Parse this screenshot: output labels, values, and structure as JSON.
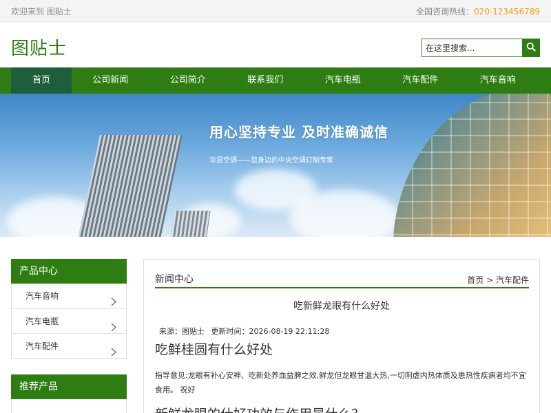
{
  "topbar": {
    "welcome": "欢迎来到 图贴士",
    "hotline_label": "全国咨询热线：",
    "hotline_phone": "020-123456789"
  },
  "header": {
    "logo": "图贴士",
    "search_placeholder": "在这里搜索...",
    "search_icon": "search-icon"
  },
  "nav": {
    "items": [
      {
        "label": "首页",
        "active": true
      },
      {
        "label": "公司新闻"
      },
      {
        "label": "公司简介"
      },
      {
        "label": "联系我们"
      },
      {
        "label": "汽车电瓶"
      },
      {
        "label": "汽车配件"
      },
      {
        "label": "汽车音响"
      }
    ]
  },
  "banner": {
    "title": "用心坚持专业  及时准确诚信",
    "subtitle": "华昱空调——您身边的中央空调订制专家"
  },
  "sidebar": {
    "products_heading": "产品中心",
    "items": [
      {
        "label": "汽车音响"
      },
      {
        "label": "汽车电瓶"
      },
      {
        "label": "汽车配件"
      }
    ],
    "recommend_heading": "推荐产品"
  },
  "main": {
    "section_title": "新闻中心",
    "breadcrumb": {
      "home": "首页",
      "sep": ">",
      "current": "汽车配件"
    },
    "article_title": "吃新鲜龙眼有什么好处",
    "meta": {
      "source": "来源：图贴士",
      "updated": "更新时间：2026-08-19 22:11:28"
    },
    "heading1": "吃鲜桂圆有什么好处",
    "guide": "指导意见:龙眼有补心安神、吃新处养血益脾之效,鲜龙但龙眼甘温大热,一切阴虚内热体质及患热性疾病者均不宜食用。 祝好",
    "heading2": "新鲜龙眼的什好功效与作用是什么？"
  },
  "colors": {
    "brand_green": "#2e7d12",
    "nav_active": "#1f5e3a",
    "phone_orange": "#f39c12"
  }
}
